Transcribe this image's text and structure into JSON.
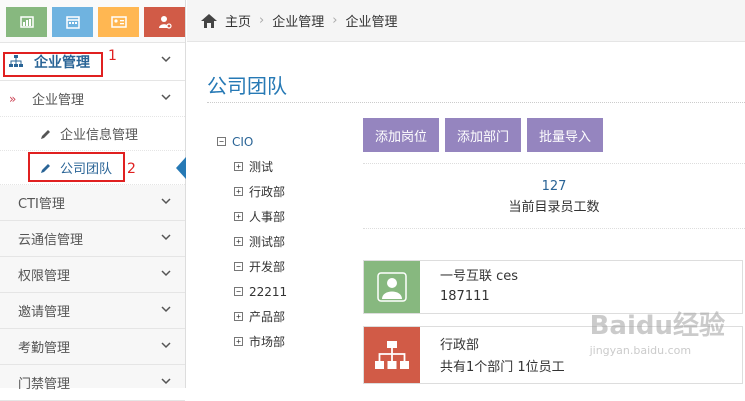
{
  "colors": {
    "shortcut1": "#87b87f",
    "shortcut2": "#6fb3e0",
    "shortcut3": "#ffb752",
    "shortcut4": "#d15b47",
    "accent": "#2679b5",
    "button": "#9585bf",
    "card1": "#87b87f",
    "card2": "#d15b47"
  },
  "breadcrumb": {
    "home": "主页",
    "level1": "企业管理",
    "level2": "企业管理"
  },
  "sidebar": {
    "top_item": "企业管理",
    "sub_group": "企业管理",
    "sub_items": [
      {
        "label": "企业信息管理"
      },
      {
        "label": "公司团队"
      }
    ],
    "items": [
      {
        "label": "CTI管理"
      },
      {
        "label": "云通信管理"
      },
      {
        "label": "权限管理"
      },
      {
        "label": "邀请管理"
      },
      {
        "label": "考勤管理"
      },
      {
        "label": "门禁管理"
      }
    ]
  },
  "annotations": {
    "label1": "1",
    "label2": "2"
  },
  "main": {
    "title": "公司团队",
    "tree": {
      "root": "CIO",
      "children": [
        {
          "label": "测试",
          "expand": "+"
        },
        {
          "label": "行政部",
          "expand": "+"
        },
        {
          "label": "人事部",
          "expand": "+"
        },
        {
          "label": "测试部",
          "expand": "+"
        },
        {
          "label": "开发部",
          "expand": "−"
        },
        {
          "label": "22211",
          "expand": "−"
        },
        {
          "label": "产品部",
          "expand": "+"
        },
        {
          "label": "市场部",
          "expand": "+"
        }
      ]
    },
    "buttons": {
      "add_position": "添加岗位",
      "add_department": "添加部门",
      "batch_import": "批量导入"
    },
    "stat": {
      "count": "127",
      "label": "当前目录员工数"
    },
    "cards": [
      {
        "name": "一号互联 ces",
        "sub": "187111"
      },
      {
        "name": "行政部",
        "sub": "共有1个部门 1位员工"
      }
    ]
  },
  "watermark": {
    "text": "Baidu经验",
    "sub": "jingyan.baidu.com"
  }
}
